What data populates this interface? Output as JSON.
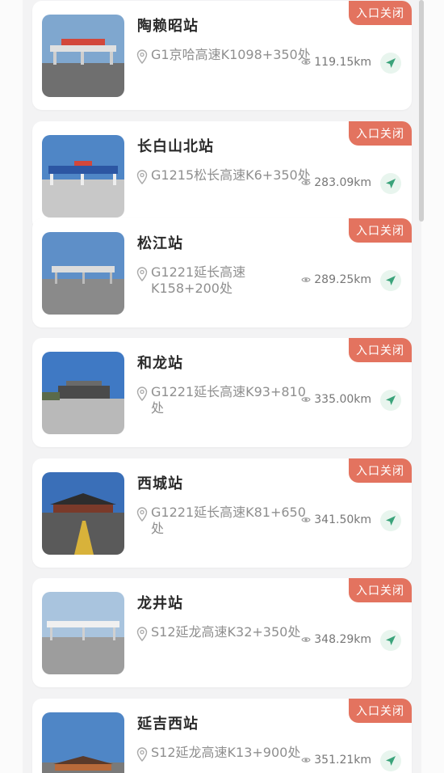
{
  "stations": [
    {
      "name": "陶赖昭站",
      "address": "G1京哈高速K1098+350处",
      "distance": "119.15km",
      "status": "入口关闭"
    },
    {
      "name": "长白山北站",
      "address": "G1215松长高速K6+350处",
      "distance": "283.09km",
      "status": "入口关闭"
    },
    {
      "name": "松江站",
      "address": "G1221延长高速K158+200处",
      "distance": "289.25km",
      "status": "入口关闭"
    },
    {
      "name": "和龙站",
      "address": "G1221延长高速K93+810处",
      "distance": "335.00km",
      "status": "入口关闭"
    },
    {
      "name": "西城站",
      "address": "G1221延长高速K81+650处",
      "distance": "341.50km",
      "status": "入口关闭"
    },
    {
      "name": "龙井站",
      "address": "S12延龙高速K32+350处",
      "distance": "348.29km",
      "status": "入口关闭"
    },
    {
      "name": "延吉西站",
      "address": "S12延龙高速K13+900处",
      "distance": "351.21km",
      "status": "入口关闭"
    }
  ],
  "colors": {
    "status_bg": "#e3735f",
    "nav_btn_bg": "#e8f5ee",
    "nav_icon": "#3aa37a"
  },
  "icons": {
    "location": "map-pin-icon",
    "distance": "eye-icon",
    "navigate": "navigation-arrow-icon"
  }
}
